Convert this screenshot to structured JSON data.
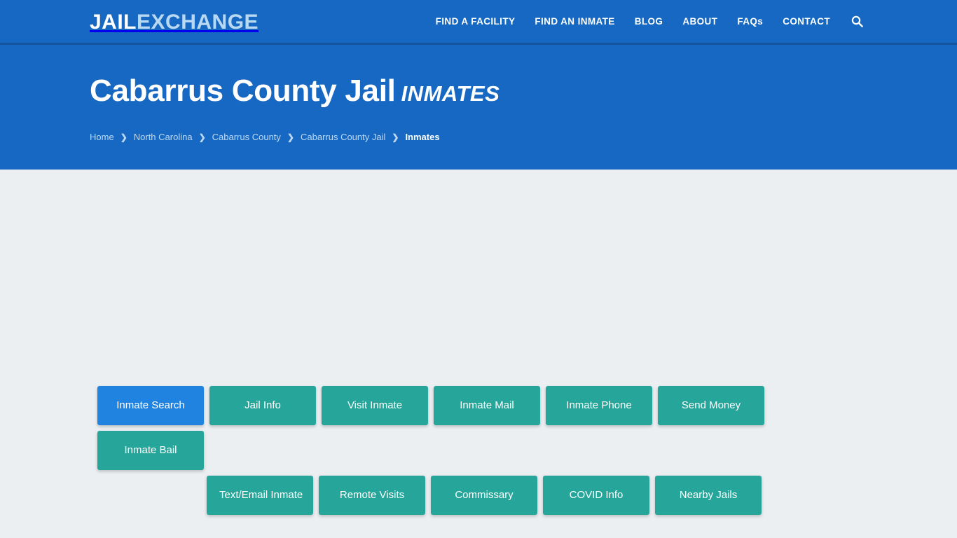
{
  "brand": {
    "part1": "JAIL",
    "part2": "EXCHANGE"
  },
  "nav": {
    "items": [
      {
        "label": "FIND A FACILITY"
      },
      {
        "label": "FIND AN INMATE"
      },
      {
        "label": "BLOG"
      },
      {
        "label": "ABOUT"
      },
      {
        "label": "FAQs"
      },
      {
        "label": "CONTACT"
      }
    ],
    "search_icon": "search-icon"
  },
  "hero": {
    "title": "Cabarrus County Jail",
    "title_suffix": "INMATES",
    "breadcrumb": [
      {
        "label": "Home",
        "current": false
      },
      {
        "label": "North Carolina",
        "current": false
      },
      {
        "label": "Cabarrus County",
        "current": false
      },
      {
        "label": "Cabarrus County Jail",
        "current": false
      },
      {
        "label": "Inmates",
        "current": true
      }
    ],
    "separator": "❯"
  },
  "tabs": {
    "row1": [
      {
        "label": "Inmate Search",
        "active": true
      },
      {
        "label": "Jail Info",
        "active": false
      },
      {
        "label": "Visit Inmate",
        "active": false
      },
      {
        "label": "Inmate Mail",
        "active": false
      },
      {
        "label": "Inmate Phone",
        "active": false
      },
      {
        "label": "Send Money",
        "active": false
      },
      {
        "label": "Inmate Bail",
        "active": false
      }
    ],
    "row2": [
      {
        "label": "Text/Email Inmate",
        "active": false
      },
      {
        "label": "Remote Visits",
        "active": false
      },
      {
        "label": "Commissary",
        "active": false
      },
      {
        "label": "COVID Info",
        "active": false
      },
      {
        "label": "Nearby Jails",
        "active": false
      }
    ]
  },
  "colors": {
    "header_blue": "#1668c2",
    "header_border": "#14539d",
    "body_gray": "#eceff1",
    "teal": "#26a69a",
    "active_blue": "#2183e0",
    "brand_light": "#b9d9f2",
    "breadcrumb_link": "#bfd9f3"
  }
}
